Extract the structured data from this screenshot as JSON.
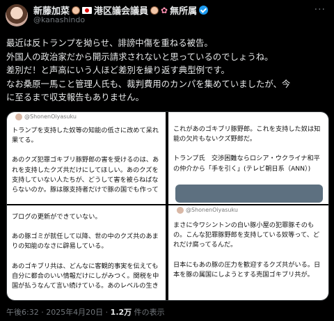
{
  "author": {
    "name": "新藤加菜",
    "title": "港区議会議員",
    "suffix": "無所属",
    "handle": "@kanashindo",
    "more_icon": "ellipsis-icon"
  },
  "tweet": {
    "lines": [
      "最近は反トランプを拗らせ、誹謗中傷を重ねる被告。",
      "外国人の政治家だから開示請求されないと思っているのでしょうね。",
      "差別だ！と声高にいう人ほど差別を繰り返す典型例です。",
      "なお桑原一馬こと管理人氏も、裁判費用のカンパを集めていましたが、今",
      "に至るまで収支報告もありません。"
    ]
  },
  "images": {
    "panel1": {
      "source": "@ShonenOiyasuku",
      "lines": [
        "トランプを支持した奴等の知能の低さに改めて呆れ",
        "果てる。",
        "",
        "あのクズ犯罪ゴキブリ豚野郎の害を受けるのは、あ",
        "れを支持したクズ共だけにしてほしい。あのクズを",
        "支持していない人たちが、どうして害を被らねばな",
        "らないのか。豚は豚支持者だけで豚の国でも作って"
      ]
    },
    "panel2": {
      "lines": [
        "これがあのゴキブリ豚野郎。これを支持した奴は知",
        "能の欠片もないクズ野郎だ。",
        "",
        "トランプ氏　交渉困難ならロシア・ウクライナ和平",
        "の仲介から「手を引く」(テレビ朝日系（ANN）)"
      ]
    },
    "panel3": {
      "lines": [
        "ブログの更新ができていない。",
        "",
        "あの豚ゴミが就任して以降、世の中のクズ共のあま",
        "りの知能のなさに辟易している。",
        "",
        "あのゴキブリ共は、どんなに客観的事実を伝えても",
        "自分に都合のいい情報だけにしがみつく。関税を中",
        "国が払うなんて言い続けている。あのレベルの生き"
      ]
    },
    "panel4": {
      "source": "@ShonenOiyasuku",
      "lines": [
        "まさに今ワシントンの白い豚小屋の犯罪豚そのも",
        "の。こんな犯罪豚野郎を支持している奴等って、ど",
        "れだけ腐ってるんだ。",
        "",
        "日本にもあの豚の圧力を歓迎するクズ共がいる。日",
        "本を豚の属国にしようとする売国ゴキブリ共が。"
      ]
    }
  },
  "footer": {
    "time": "午後6:32 · 2025年4月20日 · ",
    "views": "1.2万",
    "views_suffix": " 件の表示"
  }
}
